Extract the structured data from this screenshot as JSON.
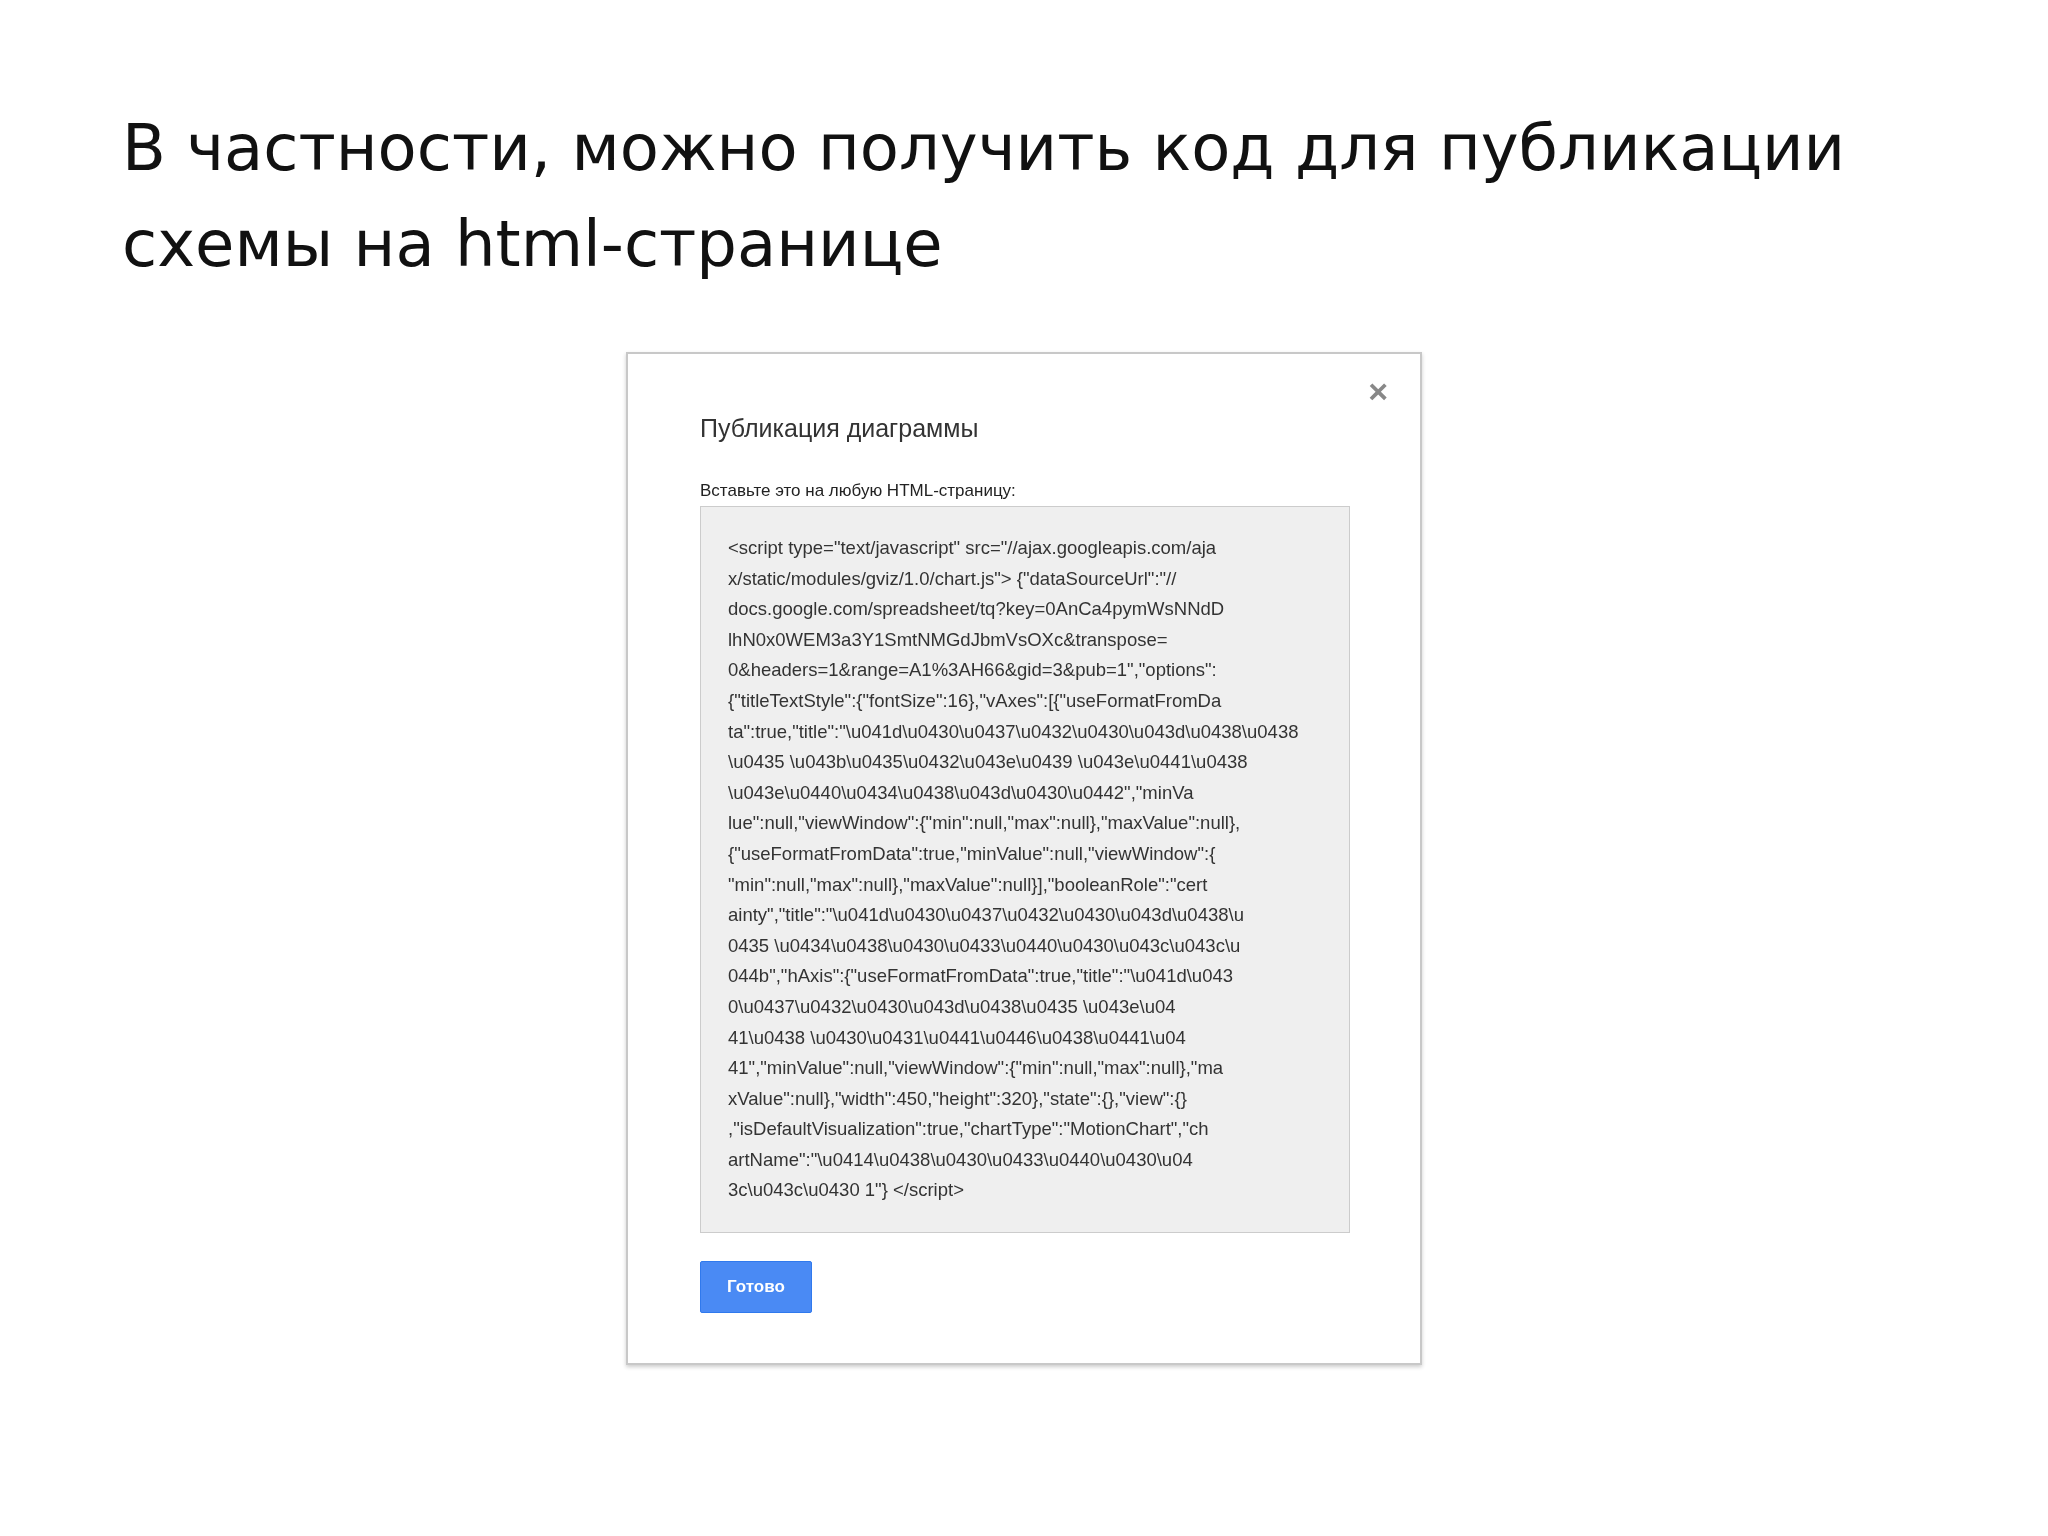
{
  "slide_title": "В частности, можно получить код для публикации схемы на html-странице",
  "dialog": {
    "title": "Публикация диаграммы",
    "close": "×",
    "label": "Вставьте это на любую HTML-страницу:",
    "code_lines": [
      "<script type=\"text/javascript\" src=\"//ajax.googleapis.com/aja",
      "x/static/modules/gviz/1.0/chart.js\"> {\"dataSourceUrl\":\"//",
      "docs.google.com/spreadsheet/tq?key=0AnCa4pymWsNNdD",
      "lhN0x0WEM3a3Y1SmtNMGdJbmVsOXc&transpose=",
      "0&headers=1&range=A1%3AH66&gid=3&pub=1\",\"options\":",
      "{\"titleTextStyle\":{\"fontSize\":16},\"vAxes\":[{\"useFormatFromDa",
      "ta\":true,\"title\":\"\\u041d\\u0430\\u0437\\u0432\\u0430\\u043d\\u0438\\u0438",
      "\\u0435 \\u043b\\u0435\\u0432\\u043e\\u0439 \\u043e\\u0441\\u0438",
      "\\u043e\\u0440\\u0434\\u0438\\u043d\\u0430\\u0442\",\"minVa",
      "lue\":null,\"viewWindow\":{\"min\":null,\"max\":null},\"maxValue\":null},",
      "{\"useFormatFromData\":true,\"minValue\":null,\"viewWindow\":{",
      "\"min\":null,\"max\":null},\"maxValue\":null}],\"booleanRole\":\"cert",
      "ainty\",\"title\":\"\\u041d\\u0430\\u0437\\u0432\\u0430\\u043d\\u0438\\u",
      "0435 \\u0434\\u0438\\u0430\\u0433\\u0440\\u0430\\u043c\\u043c\\u",
      "044b\",\"hAxis\":{\"useFormatFromData\":true,\"title\":\"\\u041d\\u043",
      "0\\u0437\\u0432\\u0430\\u043d\\u0438\\u0435 \\u043e\\u04",
      "41\\u0438 \\u0430\\u0431\\u0441\\u0446\\u0438\\u0441\\u04",
      "41\",\"minValue\":null,\"viewWindow\":{\"min\":null,\"max\":null},\"ma",
      "xValue\":null},\"width\":450,\"height\":320},\"state\":{},\"view\":{}",
      ",\"isDefaultVisualization\":true,\"chartType\":\"MotionChart\",\"ch",
      "artName\":\"\\u0414\\u0438\\u0430\\u0433\\u0440\\u0430\\u04",
      "3c\\u043c\\u0430 1\"} </script>"
    ],
    "button": "Готово"
  }
}
